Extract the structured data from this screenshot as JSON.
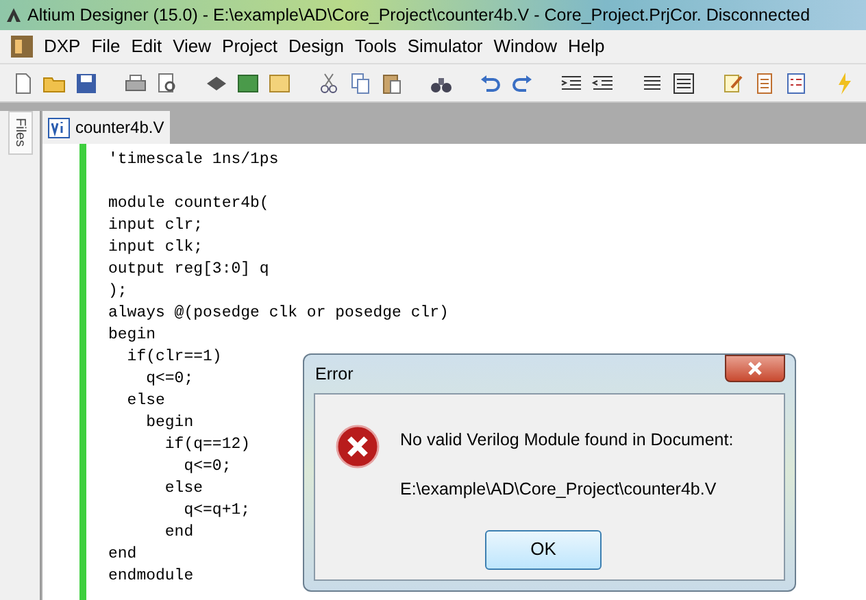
{
  "window": {
    "title": "Altium Designer (15.0) - E:\\example\\AD\\Core_Project\\counter4b.V - Core_Project.PrjCor. Disconnected"
  },
  "menu": [
    {
      "label": "DXP"
    },
    {
      "label": "File"
    },
    {
      "label": "Edit"
    },
    {
      "label": "View"
    },
    {
      "label": "Project"
    },
    {
      "label": "Design"
    },
    {
      "label": "Tools"
    },
    {
      "label": "Simulator"
    },
    {
      "label": "Window"
    },
    {
      "label": "Help"
    }
  ],
  "side_panel": {
    "tab": "Files"
  },
  "document_tabs": [
    {
      "label": "counter4b.V",
      "selected": true
    }
  ],
  "code_lines": [
    {
      "kind": "code",
      "text": "'timescale 1ns/1ps"
    },
    {
      "kind": "blank"
    },
    {
      "kind": "code",
      "text": "module counter4b("
    },
    {
      "kind": "code",
      "text": "input clr;"
    },
    {
      "kind": "code",
      "text": "input clk;"
    },
    {
      "kind": "code",
      "text": "output reg[3:0] q"
    },
    {
      "kind": "code",
      "text": ");"
    },
    {
      "kind": "code",
      "text": "always @(posedge clk or posedge clr)"
    },
    {
      "kind": "code",
      "text": "begin"
    },
    {
      "kind": "code",
      "text": "  if(clr==1)"
    },
    {
      "kind": "code",
      "text": "    q<=0;"
    },
    {
      "kind": "code",
      "text": "  else"
    },
    {
      "kind": "code",
      "text": "    begin"
    },
    {
      "kind": "code",
      "text": "      if(q==12)"
    },
    {
      "kind": "code",
      "text": "        q<=0;"
    },
    {
      "kind": "code",
      "text": "      else"
    },
    {
      "kind": "code",
      "text": "        q<=q+1;"
    },
    {
      "kind": "code",
      "text": "      end"
    },
    {
      "kind": "code",
      "text": "end"
    },
    {
      "kind": "code",
      "text": "endmodule"
    }
  ],
  "dialog": {
    "title": "Error",
    "message": "No valid Verilog Module found in Document:",
    "path": "E:\\example\\AD\\Core_Project\\counter4b.V",
    "buttons": [
      "OK"
    ]
  }
}
